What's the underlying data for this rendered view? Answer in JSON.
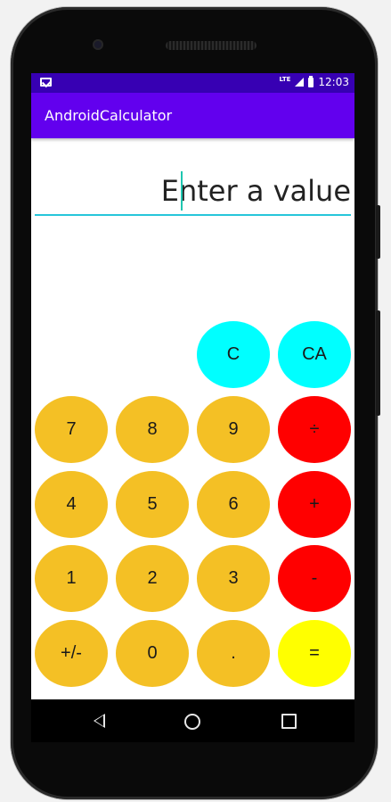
{
  "status_bar": {
    "network": "LTE",
    "time": "12:03",
    "notification_icon": "gmail-icon"
  },
  "app_bar": {
    "title": "AndroidCalculator"
  },
  "display": {
    "placeholder": "Enter a value",
    "value": ""
  },
  "buttons": {
    "clear": "C",
    "clear_all": "CA",
    "seven": "7",
    "eight": "8",
    "nine": "9",
    "divide": "÷",
    "four": "4",
    "five": "5",
    "six": "6",
    "plus": "+",
    "one": "1",
    "two": "2",
    "three": "3",
    "minus": "-",
    "negate": "+/-",
    "zero": "0",
    "decimal": ".",
    "equals": "="
  },
  "colors": {
    "status_bar": "#3700b3",
    "app_bar": "#6200ee",
    "digit": "#f4c025",
    "clear": "#00ffff",
    "operator": "#ff0000",
    "equals": "#ffff00",
    "input_underline": "#26c6da"
  }
}
